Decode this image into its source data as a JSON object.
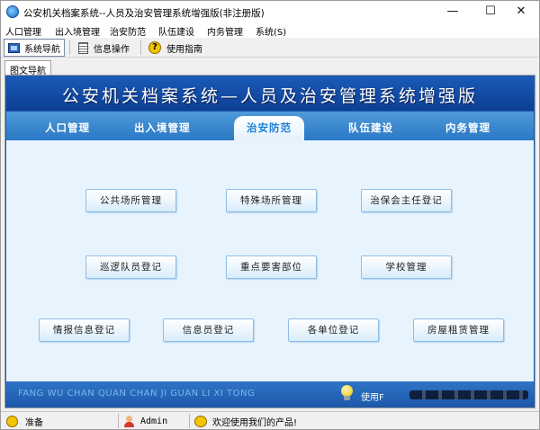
{
  "window": {
    "title": "公安机关档案系统--人员及治安管理系统增强版(非注册版)",
    "minimize_glyph": "—",
    "maximize_glyph": "☐",
    "close_glyph": "✕"
  },
  "menubar": {
    "items": [
      "人口管理",
      "出入境管理",
      "治安防范",
      "队伍建设",
      "内务管理",
      "系统(S)"
    ]
  },
  "toolbar": {
    "items": [
      {
        "label": "系统导航",
        "icon": "screen-icon",
        "active": true
      },
      {
        "label": "信息操作",
        "icon": "document-icon",
        "active": false
      },
      {
        "label": "使用指南",
        "icon": "help-icon",
        "active": false
      }
    ],
    "help_glyph": "?"
  },
  "content_tab": {
    "label": "图文导航"
  },
  "banner": {
    "title": "公安机关档案系统—人员及治安管理系统增强版"
  },
  "nav_tabs": [
    "人口管理",
    "出入境管理",
    "治安防范",
    "队伍建设",
    "内务管理"
  ],
  "selected_tab": "治安防范",
  "function_buttons": {
    "row1": [
      "公共场所管理",
      "特殊场所管理",
      "治保会主任登记"
    ],
    "row2": [
      "巡逻队员登记",
      "重点要害部位",
      "学校管理"
    ],
    "row3": [
      "情报信息登记",
      "信息员登记",
      "各单位登记",
      "房屋租赁管理"
    ]
  },
  "footer": {
    "pinyin": "FANG WU CHAN QUAN CHAN JI GUAN LI XI TONG",
    "user_label": "使用F"
  },
  "statusbar": {
    "status": "准备",
    "user": "Admin",
    "message": "欢迎使用我们的产品!"
  },
  "colors": {
    "banner_blue": "#1a5ab8",
    "tab_blue": "#3f8ad0",
    "selected_tab_text": "#1a7ed6",
    "content_bg": "#e8f4fd"
  }
}
